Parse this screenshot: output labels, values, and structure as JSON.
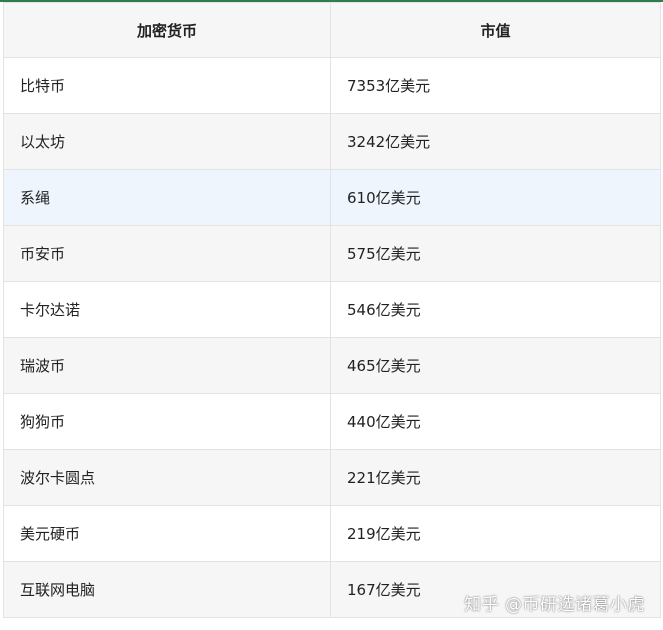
{
  "table": {
    "headers": [
      "加密货币",
      "市值"
    ],
    "rows": [
      [
        "比特币",
        "7353亿美元"
      ],
      [
        "以太坊",
        "3242亿美元"
      ],
      [
        "系绳",
        "610亿美元"
      ],
      [
        "币安币",
        "575亿美元"
      ],
      [
        "卡尔达诺",
        "546亿美元"
      ],
      [
        "瑞波币",
        "465亿美元"
      ],
      [
        "狗狗币",
        "440亿美元"
      ],
      [
        "波尔卡圆点",
        "221亿美元"
      ],
      [
        "美元硬币",
        "219亿美元"
      ],
      [
        "互联网电脑",
        "167亿美元"
      ]
    ]
  },
  "watermark": "知乎 @币研选诸葛小虎",
  "colors": {
    "accent_line": "#2e7d4f",
    "header_bg": "#f6f6f6",
    "highlight_row_bg": "#eef5fd",
    "border": "#e3e3e3"
  }
}
